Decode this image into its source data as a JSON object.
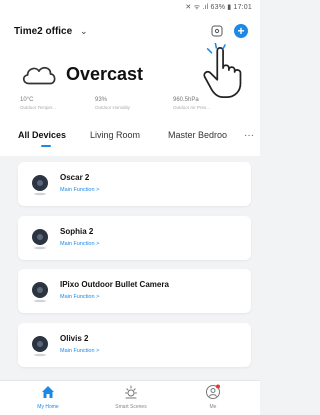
{
  "status_bar": {
    "text": "✕ ᯤ .ıl 63% ▮ 17:01"
  },
  "header": {
    "home_name": "Time2 office",
    "chevron": "⌄",
    "add_label": "+"
  },
  "icons": {
    "scan": "scan-icon",
    "add": "plus-circle-icon",
    "hand": "pointing-hand-icon",
    "cloud": "cloud-icon"
  },
  "weather": {
    "condition": "Overcast",
    "stats": [
      {
        "value": "10°C",
        "label": "Outdoor Temper..."
      },
      {
        "value": "93%",
        "label": "Outdoor Humidity"
      },
      {
        "value": "960.5hPa",
        "label": "Outdoor Air Pres..."
      }
    ]
  },
  "tabs": [
    "All Devices",
    "Living Room",
    "Master Bedroo"
  ],
  "active_tab": 0,
  "tab_more": "···",
  "devices": [
    {
      "name": "Oscar 2",
      "subtitle": "Main Function >"
    },
    {
      "name": "Sophia 2",
      "subtitle": "Main Function >"
    },
    {
      "name": "IPixo Outdoor Bullet Camera",
      "subtitle": "Main Function >"
    },
    {
      "name": "Olivis 2",
      "subtitle": "Main Function >"
    }
  ],
  "bottom_nav": [
    {
      "label": "My Home",
      "icon": "home-icon",
      "active": true
    },
    {
      "label": "Smart Scenes",
      "icon": "sun-icon",
      "active": false
    },
    {
      "label": "Me",
      "icon": "user-icon",
      "active": false
    }
  ],
  "colors": {
    "accent": "#1e88e5",
    "background": "#f2f3f5",
    "card": "#ffffff",
    "notification": "#e53935"
  }
}
